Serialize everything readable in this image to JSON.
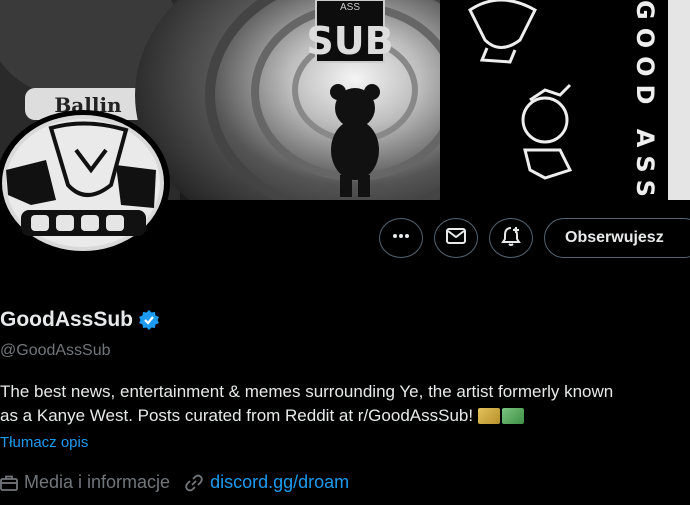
{
  "banner": {
    "logo_top": "ASS",
    "logo_main": "SUB",
    "vertical_text": "GOOD ASS SUB",
    "grill_text": "Ballin"
  },
  "actions": {
    "more_label": "More",
    "message_label": "Message",
    "notify_label": "Notifications",
    "follow_label": "Obserwujesz"
  },
  "profile": {
    "name": "GoodAssSub",
    "handle": "@GoodAssSub",
    "bio_line1": "The best news, entertainment & memes surrounding Ye, the artist formerly known",
    "bio_line2": "as a Kanye West. Posts curated from Reddit at r/GoodAssSub!",
    "translate_label": "Tłumacz opis",
    "category": "Media i informacje",
    "link": "discord.gg/droam"
  },
  "colors": {
    "accent": "#1d9bf0",
    "muted": "#71767b",
    "text": "#e7e9ea",
    "border": "#536471"
  },
  "icons": {
    "more": "ellipsis-icon",
    "message": "envelope-icon",
    "notify": "bell-plus-icon",
    "verified": "verified-badge-icon",
    "category": "briefcase-icon",
    "link": "link-icon"
  }
}
